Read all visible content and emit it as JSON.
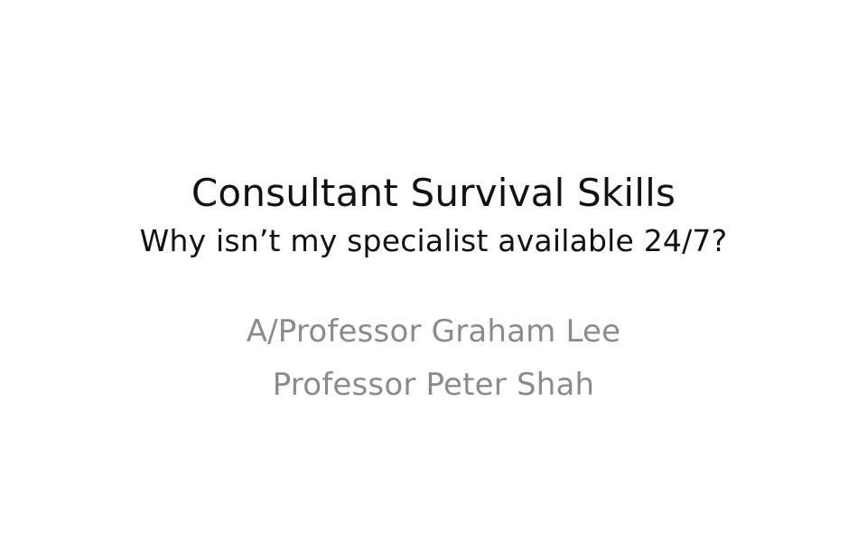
{
  "slide": {
    "title": "Consultant Survival Skills",
    "subtitle": "Why isn’t my specialist available 24/7?",
    "authors": [
      "A/Professor Graham Lee",
      "Professor Peter Shah"
    ]
  },
  "colors": {
    "background": "#ffffff",
    "title_text": "#111111",
    "author_text": "#8b8b8b"
  }
}
